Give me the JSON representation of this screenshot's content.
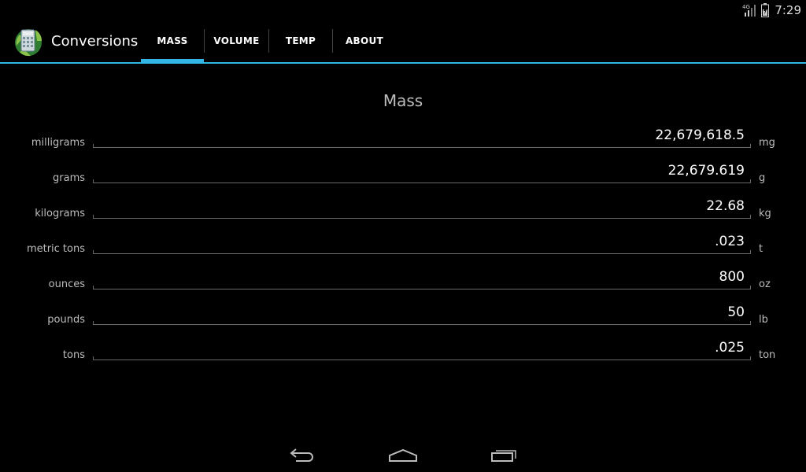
{
  "status_bar": {
    "network_label": "4G",
    "time": "7:29"
  },
  "app": {
    "title": "Conversions",
    "accent_color": "#33b5e5"
  },
  "tabs": [
    {
      "label": "MASS",
      "active": true
    },
    {
      "label": "VOLUME",
      "active": false
    },
    {
      "label": "TEMP",
      "active": false
    },
    {
      "label": "ABOUT",
      "active": false
    }
  ],
  "section": {
    "title": "Mass"
  },
  "rows": [
    {
      "label": "milligrams",
      "value": "22,679,618.5",
      "unit": "mg"
    },
    {
      "label": "grams",
      "value": "22,679.619",
      "unit": "g"
    },
    {
      "label": "kilograms",
      "value": "22.68",
      "unit": "kg"
    },
    {
      "label": "metric tons",
      "value": ".023",
      "unit": "t"
    },
    {
      "label": "ounces",
      "value": "800",
      "unit": "oz"
    },
    {
      "label": "pounds",
      "value": "50",
      "unit": "lb"
    },
    {
      "label": "tons",
      "value": ".025",
      "unit": "ton"
    }
  ],
  "nav_bar": {
    "icons": [
      "back-icon",
      "home-icon",
      "recent-apps-icon"
    ]
  }
}
